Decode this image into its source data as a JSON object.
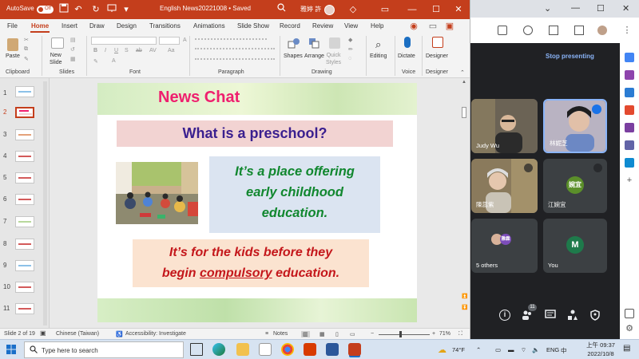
{
  "ppt": {
    "autosave_label": "AutoSave",
    "autosave_state": "Off",
    "doc_title": "English News20221008  •  Saved",
    "user_name": "雅婷 許",
    "menu_tabs": [
      "File",
      "Home",
      "Insert",
      "Draw",
      "Design",
      "Transitions",
      "Animations",
      "Slide Show",
      "Record",
      "Review",
      "View",
      "Help"
    ],
    "active_tab": "Home",
    "ribbon": {
      "paste": "Paste",
      "new_slide": "New\nSlide",
      "shapes": "Shapes",
      "arrange": "Arrange",
      "quick_styles": "Quick\nStyles",
      "editing": "Editing",
      "dictate": "Dictate",
      "designer": "Designer",
      "groups": [
        "Clipboard",
        "Slides",
        "Font",
        "Paragraph",
        "Drawing",
        "Voice",
        "Designer"
      ]
    },
    "thumb_numbers": [
      "1",
      "2",
      "3",
      "4",
      "5",
      "6",
      "7",
      "8",
      "9",
      "10",
      "11"
    ],
    "selected_slide": 2,
    "slide": {
      "title": "News Chat",
      "question": "What is a preschool?",
      "answer_lines": [
        "It’s a place offering",
        "early childhood",
        "education."
      ],
      "kids_line1": "It’s for the kids before they",
      "kids_pre": "begin ",
      "kids_underlined": "compulsory",
      "kids_post": " education."
    },
    "status": {
      "slide_info": "Slide 2 of 19",
      "language": "Chinese (Taiwan)",
      "accessibility": "Accessibility: Investigate",
      "notes": "Notes",
      "zoom": "71%"
    }
  },
  "meet": {
    "stop_presenting": "Stop presenting",
    "participants": [
      {
        "name": "Judy Wu"
      },
      {
        "name": "林妮芝"
      },
      {
        "name": "陳蕊紫"
      },
      {
        "name": "江婉宜",
        "initials": "婉宜"
      },
      {
        "name": "5 others",
        "initials": "雅霖"
      },
      {
        "name": "You",
        "initials": "M"
      }
    ],
    "participant_count": "11"
  },
  "taskbar": {
    "search_placeholder": "Type here to search",
    "temperature": "74°F",
    "lang": "ENG",
    "time": "上午 09:37",
    "date": "2022/10/8"
  }
}
